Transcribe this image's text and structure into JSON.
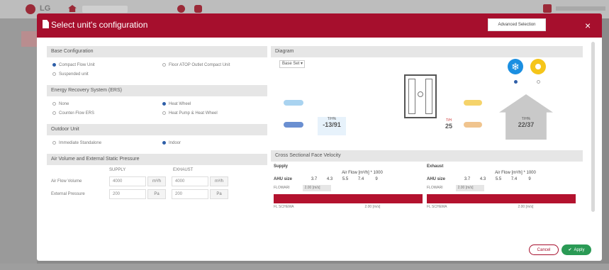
{
  "modal": {
    "title": "Select unit's configuration",
    "advanced_selection": "Advanced Selection",
    "close": "×",
    "cancel": "Cancel",
    "apply": "Apply"
  },
  "base_config": {
    "title": "Base Configuration",
    "options": [
      "Compact Flow Unit",
      "Floor ATOP Outlet Compact Unit",
      "Suspended unit"
    ]
  },
  "ers": {
    "title": "Energy Recovery System (ERS)",
    "options": [
      "None",
      "Heat Wheel",
      "Counter-Flow ERS",
      "Heat Pump & Heat Wheel"
    ]
  },
  "outdoor": {
    "title": "Outdoor Unit",
    "options": [
      "Immediate Standalone",
      "Indoor"
    ]
  },
  "airvol": {
    "title": "Air Volume and External Static Pressure",
    "supply_header": "SUPPLY",
    "exhaust_header": "EXHAUST",
    "rows": [
      {
        "label": "Air Flow Volume",
        "supply": "4000",
        "supply_unit": "m³/h",
        "exhaust": "4000",
        "exhaust_unit": "m³/h"
      },
      {
        "label": "External Pressure",
        "supply": "200",
        "supply_unit": "Pa",
        "exhaust": "200",
        "exhaust_unit": "Pa"
      }
    ]
  },
  "diagram": {
    "title": "Diagram",
    "select_value": "Base Set",
    "outside_temp": "-13/91",
    "outside_label": "T/H%",
    "exhaust_temp": "25",
    "exhaust_label": "T/H",
    "room_temp": "22/37",
    "room_label": "T/H%"
  },
  "cross": {
    "title": "Cross Sectional Face Velocity",
    "supply": {
      "title": "Supply",
      "af_title": "Air Flow [m³/h] * 1000",
      "ahu_label": "AHU size",
      "values": [
        "3.7",
        "4.3",
        "5.5",
        "7.4",
        "9"
      ],
      "row2_label": "FLOWARI",
      "pill": "2.00 [m/s]",
      "row3_label": "FL SCHEMA",
      "row3_val": "2.00 [m/s]"
    },
    "exhaust": {
      "title": "Exhaust",
      "af_title": "Air Flow [m³/h] * 1000",
      "ahu_label": "AHU size",
      "values": [
        "3.7",
        "4.3",
        "5.5",
        "7.4",
        "9"
      ],
      "row2_label": "FLOWARI",
      "pill": "2.00 [m/s]",
      "row3_label": "FL SCHEMA",
      "row3_val": "2.00 [m/s]"
    }
  },
  "colors": {
    "brand": "#a60f2d",
    "apply": "#2a9a55",
    "cold": "#1b8fe1",
    "warm": "#f5c51a"
  }
}
